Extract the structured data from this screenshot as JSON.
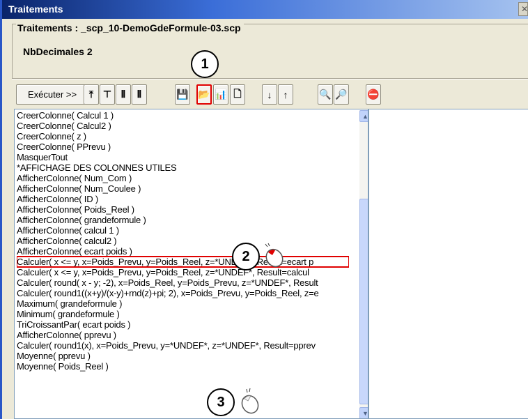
{
  "window": {
    "title": "Traitements",
    "close_glyph": "✕"
  },
  "group": {
    "legend": "Traitements : _scp_10-DemoGdeFormule-03.scp",
    "content": "NbDecimales 2"
  },
  "toolbar": {
    "execute_label": "Exécuter >>",
    "icons": [
      {
        "name": "insert-first-icon",
        "glyph": "⤒"
      },
      {
        "name": "insert-before-icon",
        "glyph": "⊤"
      },
      {
        "name": "insert-multi-icon",
        "glyph": "⫴"
      },
      {
        "name": "insert-block-icon",
        "glyph": "⦀"
      },
      {
        "name": "save-icon",
        "glyph": "💾"
      },
      {
        "name": "open-folder-icon",
        "glyph": "📂"
      },
      {
        "name": "chart-icon",
        "glyph": "📊"
      },
      {
        "name": "new-document-icon",
        "glyph": "🗋"
      },
      {
        "name": "move-down-icon",
        "glyph": "↓"
      },
      {
        "name": "move-up-icon",
        "glyph": "↑"
      },
      {
        "name": "find-icon",
        "glyph": "🔍"
      },
      {
        "name": "find-next-icon",
        "glyph": "🔎"
      },
      {
        "name": "stop-icon",
        "glyph": "⛔"
      }
    ]
  },
  "callouts": {
    "one": "1",
    "two": "2",
    "three": "3"
  },
  "script_lines": [
    "CreerColonne( Calcul 1 )",
    "CreerColonne( Calcul2 )",
    "CreerColonne( z )",
    "CreerColonne( PPrevu )",
    "MasquerTout",
    "*AFFICHAGE DES COLONNES UTILES",
    "AfficherColonne( Num_Com )",
    "AfficherColonne( Num_Coulee )",
    "AfficherColonne( ID )",
    "AfficherColonne( Poids_Reel )",
    "AfficherColonne( grandeformule )",
    "AfficherColonne( calcul 1 )",
    "AfficherColonne( calcul2 )",
    "AfficherColonne( ecart poids )",
    "Calculer( x <= y, x=Poids_Prevu, y=Poids_Reel, z=*UNDEF*, Result=ecart p",
    "Calculer(  x <= y, x=Poids_Prevu, y=Poids_Reel, z=*UNDEF*, Result=calcul",
    "Calculer( round( x - y; -2), x=Poids_Reel, y=Poids_Prevu, z=*UNDEF*, Result",
    "Calculer( round1((x+y)/(x-y)+rnd(z)+pi; 2), x=Poids_Prevu, y=Poids_Reel, z=e",
    "Maximum( grandeformule )",
    "Minimum( grandeformule )",
    "TriCroissantPar( ecart poids )",
    "AfficherColonne( pprevu )",
    "Calculer( round1(x), x=Poids_Prevu, y=*UNDEF*, z=*UNDEF*, Result=pprev",
    "Moyenne( pprevu )",
    "Moyenne( Poids_Reel )"
  ],
  "selected_line_index": 14,
  "colors": {
    "highlight": "#e00000",
    "titlebar": "#0a246a"
  }
}
